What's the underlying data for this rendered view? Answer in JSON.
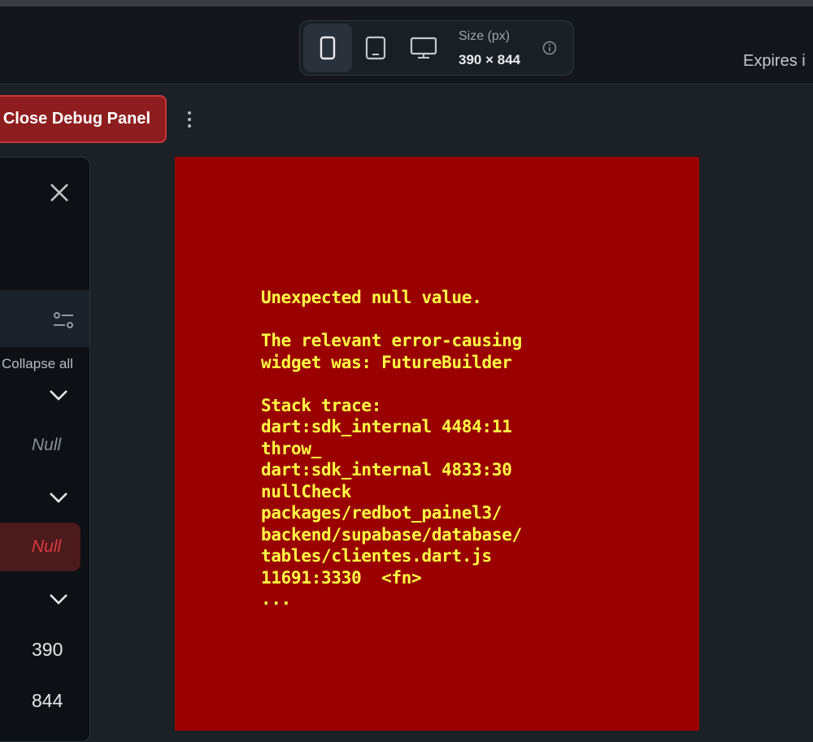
{
  "toolbar": {
    "size_label": "Size (px)",
    "size_value": "390 × 844",
    "expires_text": "Expires i",
    "devices": [
      {
        "icon": "phone-icon",
        "active": true
      },
      {
        "icon": "tablet-icon",
        "active": false
      },
      {
        "icon": "desktop-icon",
        "active": false
      }
    ]
  },
  "debug": {
    "close_label": "Close Debug Panel"
  },
  "panel": {
    "collapse_all": "Collapse all",
    "null_value_1": "Null",
    "null_value_2": "Null",
    "width_value": "390",
    "height_value": "844"
  },
  "error": {
    "text": "Unexpected null value.\n\nThe relevant error-causing\nwidget was: FutureBuilder\n\nStack trace:\ndart:sdk_internal 4484:11\nthrow_\ndart:sdk_internal 4833:30\nnullCheck\npackages/redbot_painel3/\nbackend/supabase/database/\ntables/clientes.dart.js\n11691:3330  <fn>\n..."
  },
  "colors": {
    "error_bg": "#9b0000",
    "error_text": "#ffff44",
    "debug_button": "#8e1d1f",
    "accent_red": "#e0393e"
  }
}
